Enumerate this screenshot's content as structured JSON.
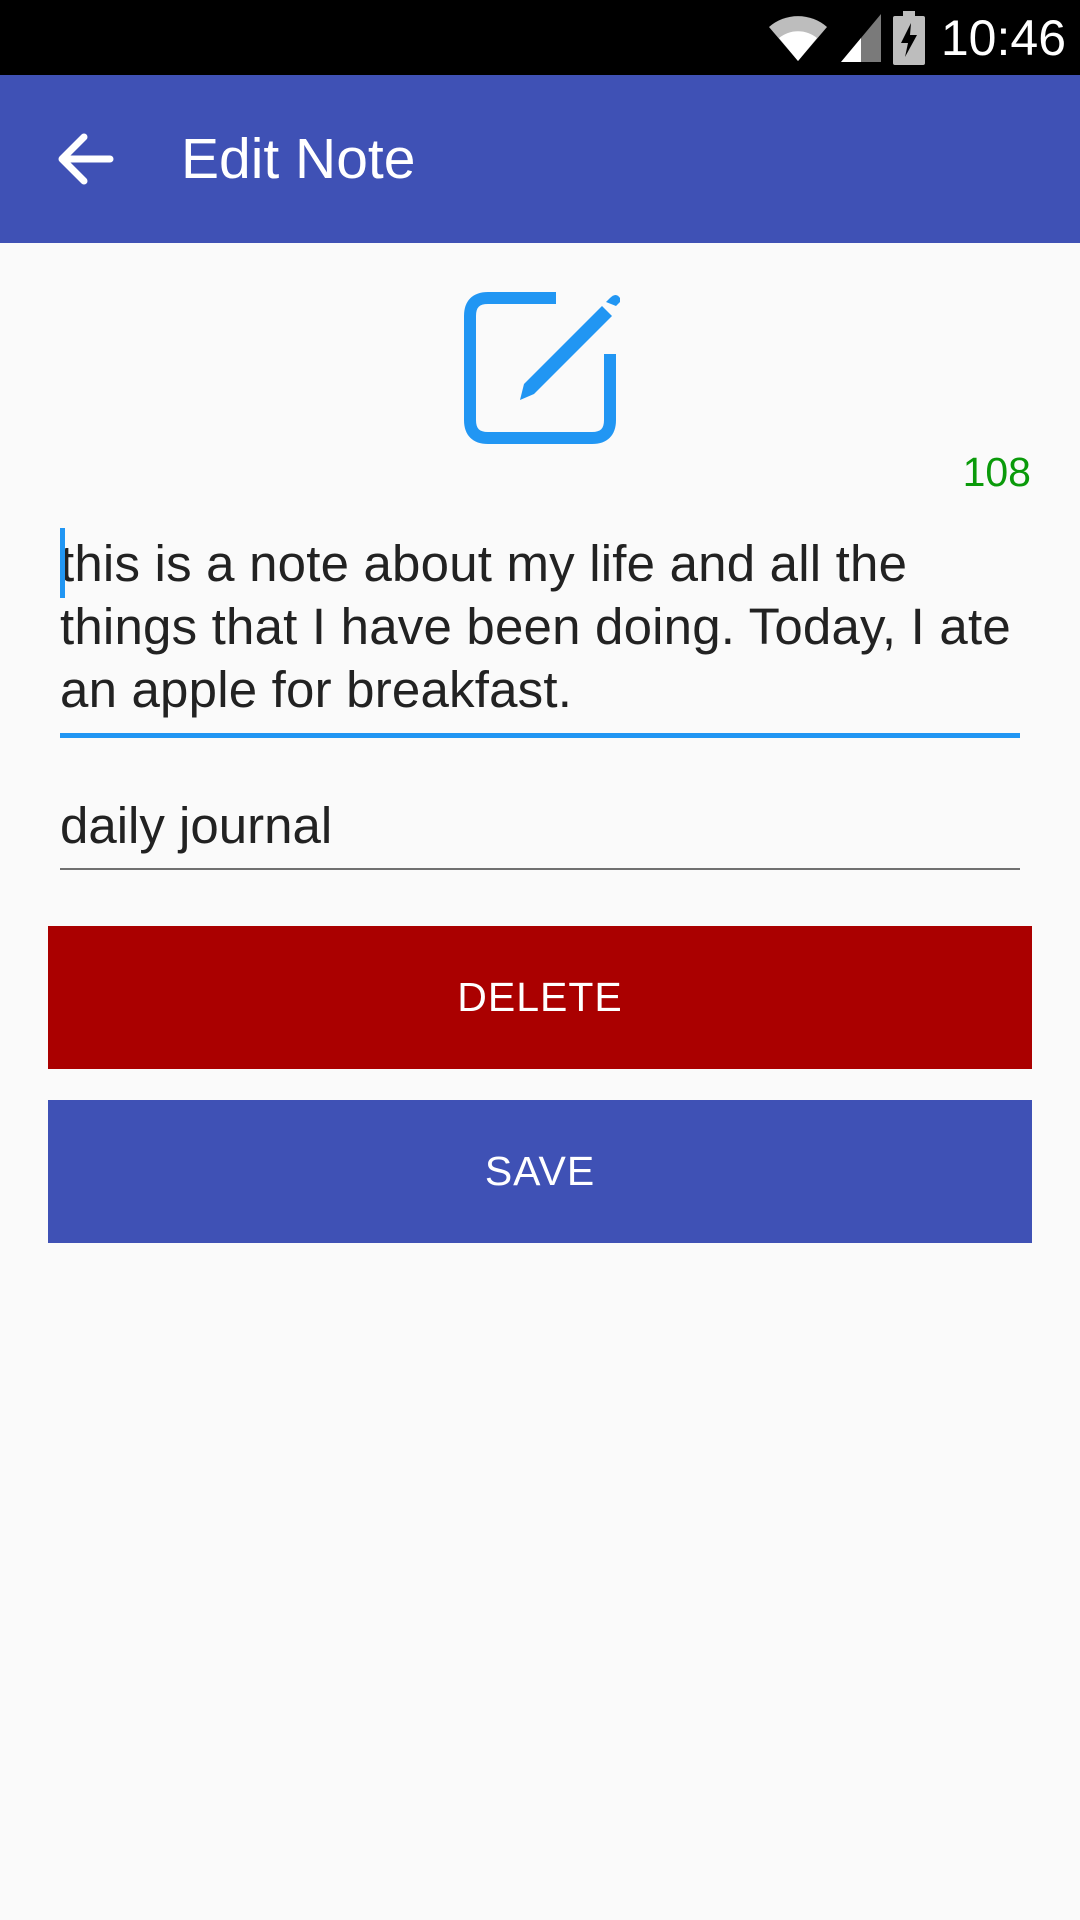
{
  "status_bar": {
    "time": "10:46",
    "icons": [
      "wifi-icon",
      "signal-icon",
      "battery-charging-icon"
    ]
  },
  "app_bar": {
    "title": "Edit Note",
    "back_icon": "arrow-back-icon"
  },
  "header_icon": "edit-note-icon",
  "char_count": "108",
  "note": {
    "body": "this is a note about my life and all the things that I have been doing. Today, I ate an apple for breakfast.",
    "tag": "daily journal"
  },
  "buttons": {
    "delete_label": "DELETE",
    "save_label": "SAVE"
  },
  "colors": {
    "primary": "#3f51b5",
    "accent": "#2196f3",
    "delete": "#aa0000",
    "count": "#0a9a0a"
  }
}
